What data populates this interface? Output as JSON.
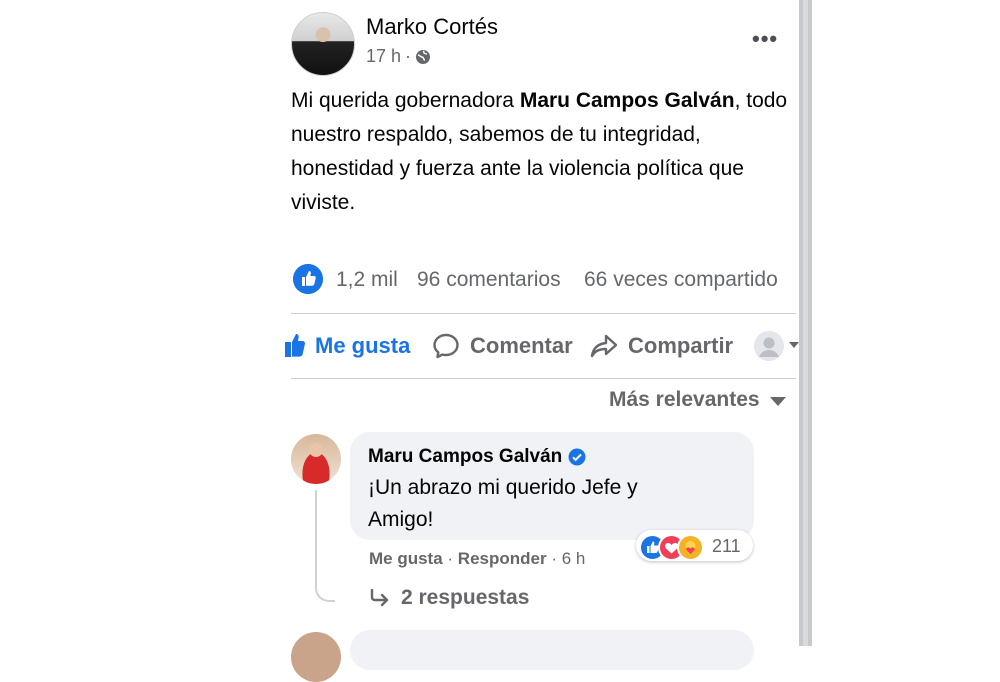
{
  "post": {
    "author": "Marko Cortés",
    "time": "17 h",
    "dot": "·",
    "more": "•••",
    "text_before": "Mi querida gobernadora ",
    "text_bold": "Maru Campos Galván",
    "text_after": ", todo nuestro respaldo, sabemos de tu integridad, honestidad y fuerza ante la violencia política que viviste."
  },
  "stats": {
    "likes": "1,2 mil",
    "comments": "96 comentarios",
    "shares": "66 veces compartido"
  },
  "actions": {
    "like": "Me gusta",
    "comment": "Comentar",
    "share": "Compartir"
  },
  "sort": {
    "label": "Más relevantes"
  },
  "comment": {
    "author": "Maru Campos Galván",
    "text": "¡Un abrazo mi querido Jefe y Amigo!",
    "reaction_count": "211",
    "like": "Me gusta",
    "sep": " · ",
    "reply": "Responder",
    "time": "6 h",
    "replies": "2 respuestas"
  },
  "colors": {
    "accent": "#1b74e4",
    "secondary_text": "#65676b",
    "bubble": "#f0f2f5"
  },
  "icons": {
    "audience": "globe-icon",
    "like_reaction": "thumbs-up-icon",
    "comment": "speech-bubble-icon",
    "share": "share-arrow-icon",
    "verified": "verified-badge-icon",
    "reply_arrow": "reply-arrow-icon"
  }
}
